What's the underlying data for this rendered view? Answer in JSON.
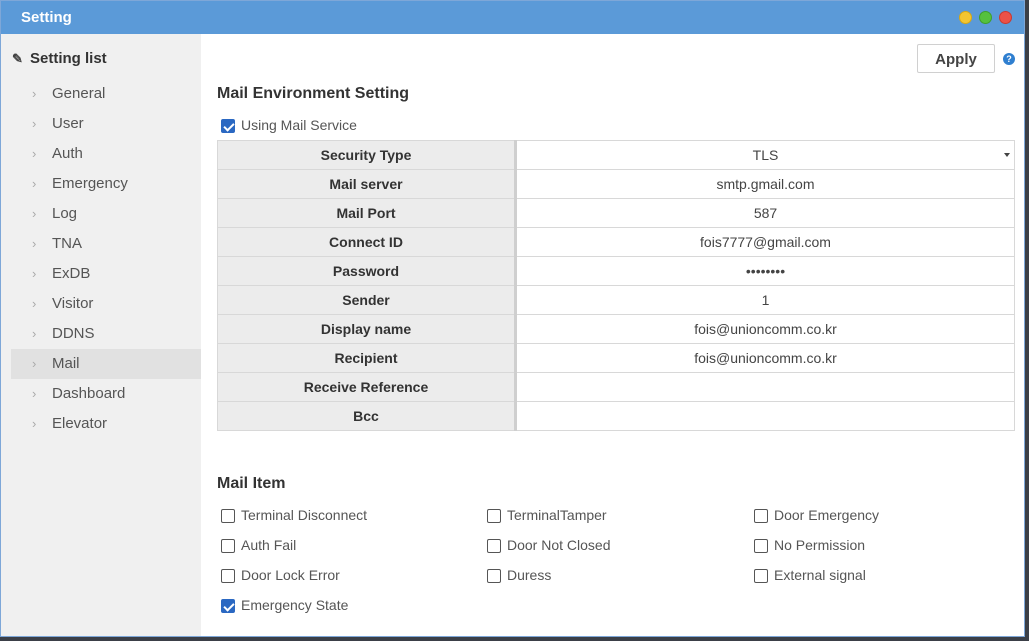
{
  "window": {
    "title": "Setting"
  },
  "sidebar": {
    "header": "Setting list",
    "items": [
      {
        "label": "General"
      },
      {
        "label": "User"
      },
      {
        "label": "Auth"
      },
      {
        "label": "Emergency"
      },
      {
        "label": "Log"
      },
      {
        "label": "TNA"
      },
      {
        "label": "ExDB"
      },
      {
        "label": "Visitor"
      },
      {
        "label": "DDNS"
      },
      {
        "label": "Mail",
        "active": true
      },
      {
        "label": "Dashboard"
      },
      {
        "label": "Elevator"
      }
    ]
  },
  "toolbar": {
    "apply_label": "Apply",
    "help_glyph": "?"
  },
  "mail_env": {
    "title": "Mail Environment Setting",
    "using_mail_service": {
      "label": "Using Mail Service",
      "checked": true
    },
    "fields": [
      {
        "label": "Security Type",
        "value": "TLS",
        "type": "select"
      },
      {
        "label": "Mail server",
        "value": "smtp.gmail.com"
      },
      {
        "label": "Mail Port",
        "value": "587"
      },
      {
        "label": "Connect ID",
        "value": "fois7777@gmail.com"
      },
      {
        "label": "Password",
        "value": "••••••••"
      },
      {
        "label": "Sender",
        "value": "1"
      },
      {
        "label": "Display name",
        "value": "fois@unioncomm.co.kr"
      },
      {
        "label": "Recipient",
        "value": "fois@unioncomm.co.kr"
      },
      {
        "label": "Receive Reference",
        "value": ""
      },
      {
        "label": "Bcc",
        "value": ""
      }
    ]
  },
  "mail_item": {
    "title": "Mail Item",
    "items": [
      {
        "label": "Terminal Disconnect",
        "checked": false
      },
      {
        "label": "TerminalTamper",
        "checked": false
      },
      {
        "label": "Door Emergency",
        "checked": false
      },
      {
        "label": "Auth Fail",
        "checked": false
      },
      {
        "label": "Door Not Closed",
        "checked": false
      },
      {
        "label": "No Permission",
        "checked": false
      },
      {
        "label": "Door Lock Error",
        "checked": false
      },
      {
        "label": "Duress",
        "checked": false
      },
      {
        "label": "External signal",
        "checked": false
      },
      {
        "label": "Emergency State",
        "checked": true
      }
    ]
  },
  "colors": {
    "titlebar": "#5b9ad8",
    "checkbox_checked": "#2a68c2",
    "sidebar_bg": "#f0f0f0"
  }
}
